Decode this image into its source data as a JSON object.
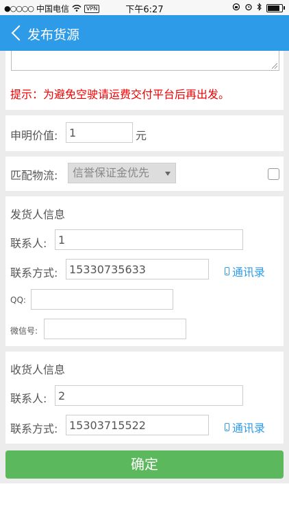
{
  "statusbar": {
    "signal": "●○○○○",
    "carrier": "中国电信",
    "vpn": "VPN",
    "time": "下午6:27"
  },
  "navbar": {
    "title": "发布货源"
  },
  "tip": "提示：为避免空驶请运费交付平台后再出发。",
  "declared_value": {
    "label": "申明价值:",
    "value": "1",
    "unit": "元"
  },
  "match_logistics": {
    "label": "匹配物流:",
    "selected": "信誉保证金优先",
    "checked": false
  },
  "sender": {
    "title": "发货人信息",
    "contact_label": "联系人:",
    "contact_value": "1",
    "phone_label": "联系方式:",
    "phone_value": "15330735633",
    "contacts_link": "通讯录",
    "qq_label": "QQ:",
    "qq_value": "",
    "wechat_label": "微信号:",
    "wechat_value": ""
  },
  "receiver": {
    "title": "收货人信息",
    "contact_label": "联系人:",
    "contact_value": "2",
    "phone_label": "联系方式:",
    "phone_value": "15303715522",
    "contacts_link": "通讯录"
  },
  "confirm_label": "确定",
  "colors": {
    "nav": "#2e9be8",
    "tip": "#ee0000",
    "confirm": "#5cb85c",
    "link": "#2e9be8"
  }
}
